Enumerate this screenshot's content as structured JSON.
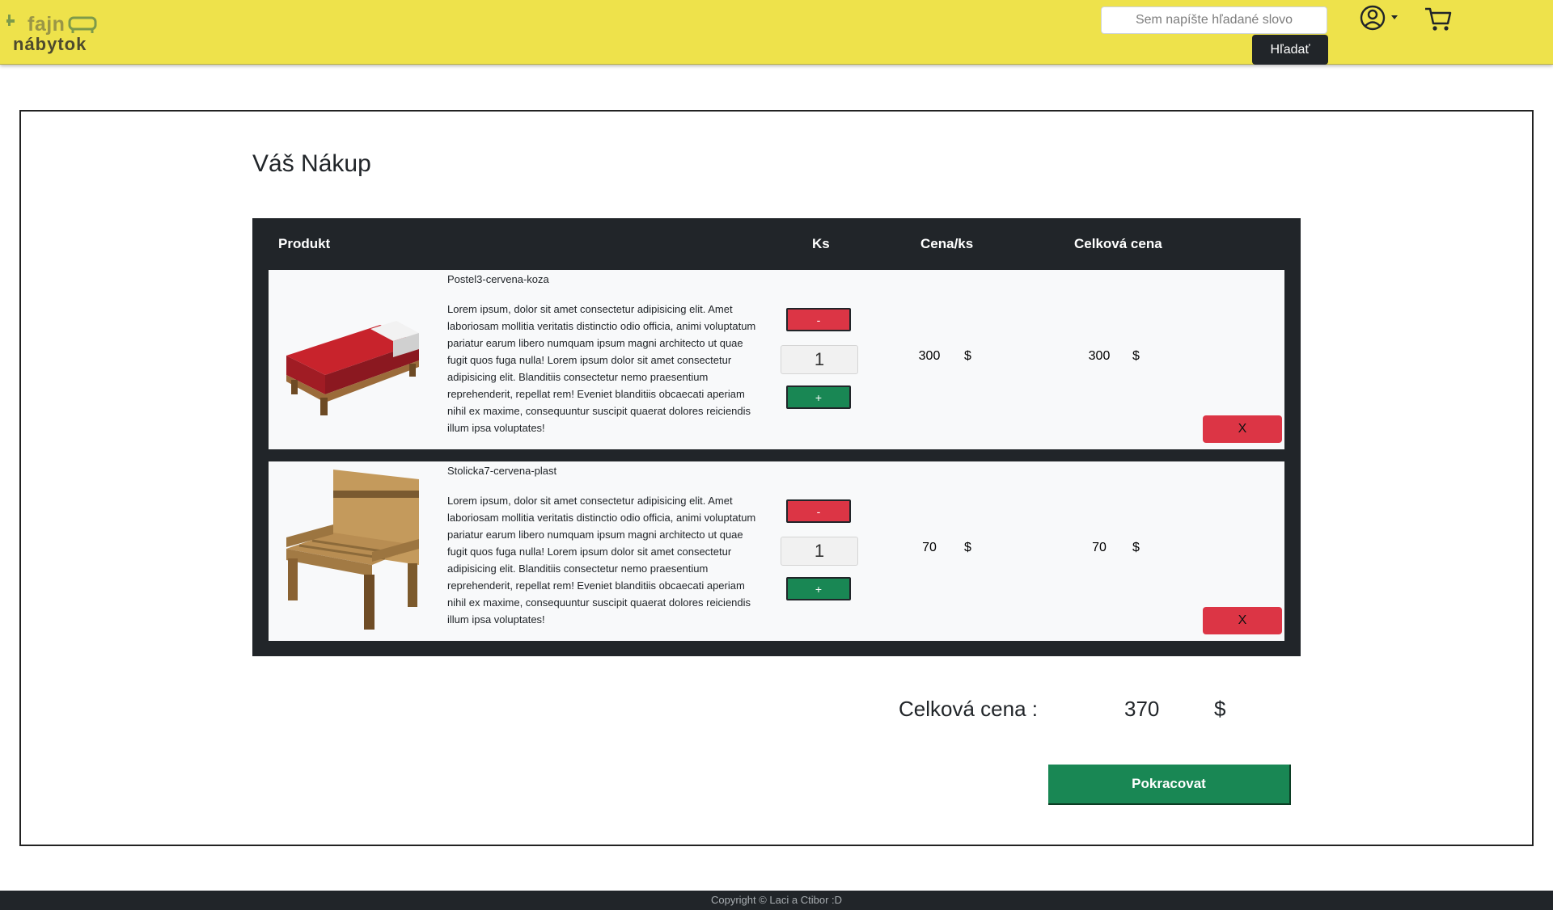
{
  "brand": {
    "line1": "fajn",
    "line2": "nábytok"
  },
  "search": {
    "placeholder": "Sem napíšte hľadané slovo",
    "button_label": "Hľadať"
  },
  "icons": {
    "user": "user-circle-icon",
    "dropdown": "caret-down-icon",
    "cart": "shopping-cart-icon"
  },
  "page": {
    "title": "Váš Nákup"
  },
  "table": {
    "headers": {
      "product": "Produkt",
      "qty": "Ks",
      "unit_price": "Cena/ks",
      "total_price": "Celková cena"
    }
  },
  "items": [
    {
      "name": "Postel3-cervena-koza",
      "description": "Lorem ipsum, dolor sit amet consectetur adipisicing elit. Amet laboriosam mollitia veritatis distinctio odio officia, animi voluptatum pariatur earum libero numquam ipsum magni architecto ut quae fugit quos fuga nulla! Lorem ipsum dolor sit amet consectetur adipisicing elit. Blanditiis consectetur nemo praesentium reprehenderit, repellat rem! Eveniet blanditiis obcaecati aperiam nihil ex maxime, consequuntur suscipit quaerat dolores reiciendis illum ipsa voluptates!",
      "minus": "-",
      "qty": "1",
      "plus": "+",
      "unit_price": "300",
      "unit_currency": "$",
      "total_price": "300",
      "total_currency": "$",
      "remove": "X"
    },
    {
      "name": "Stolicka7-cervena-plast",
      "description": "Lorem ipsum, dolor sit amet consectetur adipisicing elit. Amet laboriosam mollitia veritatis distinctio odio officia, animi voluptatum pariatur earum libero numquam ipsum magni architecto ut quae fugit quos fuga nulla! Lorem ipsum dolor sit amet consectetur adipisicing elit. Blanditiis consectetur nemo praesentium reprehenderit, repellat rem! Eveniet blanditiis obcaecati aperiam nihil ex maxime, consequuntur suscipit quaerat dolores reiciendis illum ipsa voluptates!",
      "minus": "-",
      "qty": "1",
      "plus": "+",
      "unit_price": "70",
      "unit_currency": "$",
      "total_price": "70",
      "total_currency": "$",
      "remove": "X"
    }
  ],
  "summary": {
    "label": "Celková cena :",
    "total": "370",
    "currency": "$",
    "continue_label": "Pokracovat"
  },
  "footer": {
    "text": "Copyright © Laci a Ctibor :D"
  },
  "colors": {
    "navbar": "#eee24b",
    "dark": "#212529",
    "danger": "#dc3545",
    "success": "#198754"
  }
}
